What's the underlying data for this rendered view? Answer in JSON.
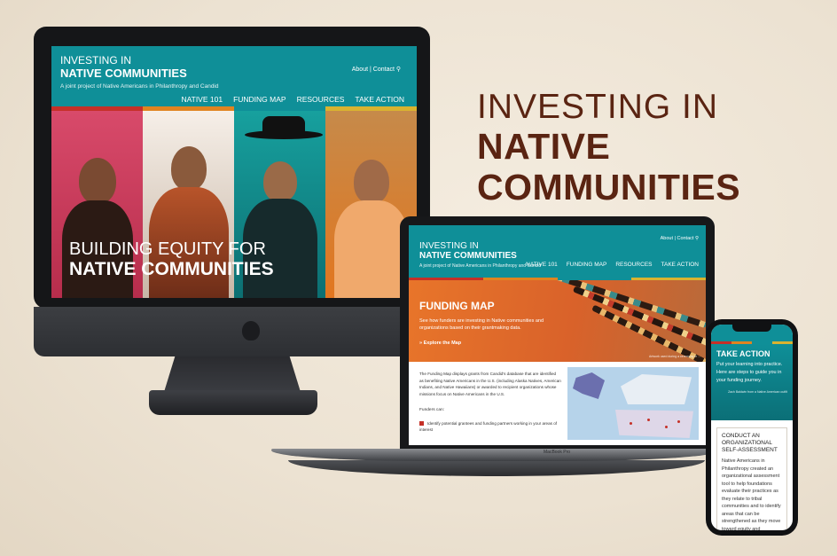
{
  "headline": {
    "line1": "INVESTING IN",
    "line2": "NATIVE COMMUNITIES"
  },
  "site": {
    "brand_line1": "INVESTING IN",
    "brand_line2": "NATIVE COMMUNITIES",
    "tagline": "A joint project of Native Americans in Philanthropy and Candid",
    "util_about": "About",
    "util_sep": "|",
    "util_contact": "Contact",
    "nav": [
      "NATIVE 101",
      "FUNDING MAP",
      "RESOURCES",
      "TAKE ACTION"
    ]
  },
  "desktop": {
    "hero_line1": "BUILDING EQUITY FOR",
    "hero_line2": "NATIVE COMMUNITIES"
  },
  "laptop": {
    "page_title": "FUNDING MAP",
    "intro": "See how funders are investing in Native communities and organizations based on their grantmaking data.",
    "cta": "Explore the Map",
    "caption": "Artwork used during a ceremony in ...",
    "body_text": "The Funding Map displays grants from Candid's database that are identified as benefiting Native Americans in the U.S. (including Alaska Natives, American Indians, and Native Hawaiians) or awarded to recipient organizations whose missions focus on Native Americans in the U.S.",
    "funders_can": "Funders can:",
    "bullet1": "Identify potential grantees and funding partners working in your areas of interest",
    "model": "MacBook Pro"
  },
  "phone": {
    "title": "TAKE ACTION",
    "intro": "Put your learning into practice. Here are steps to guide you in your funding journey.",
    "quote_credit": "Zach Baldwin from a Native American outfit",
    "card_title": "CONDUCT AN ORGANIZATIONAL SELF-ASSESSMENT",
    "card_text": "Native Americans in Philanthropy created an organizational assessment tool to help foundations evaluate their practices as they relate to tribal communities and to identify areas that can be strengthened as they move toward equity and effectiveness."
  },
  "colors": {
    "teal": "#0f8f98",
    "red": "#c53027",
    "orange": "#e08420",
    "gold": "#d9b330",
    "headline_brown": "#5a2412"
  }
}
